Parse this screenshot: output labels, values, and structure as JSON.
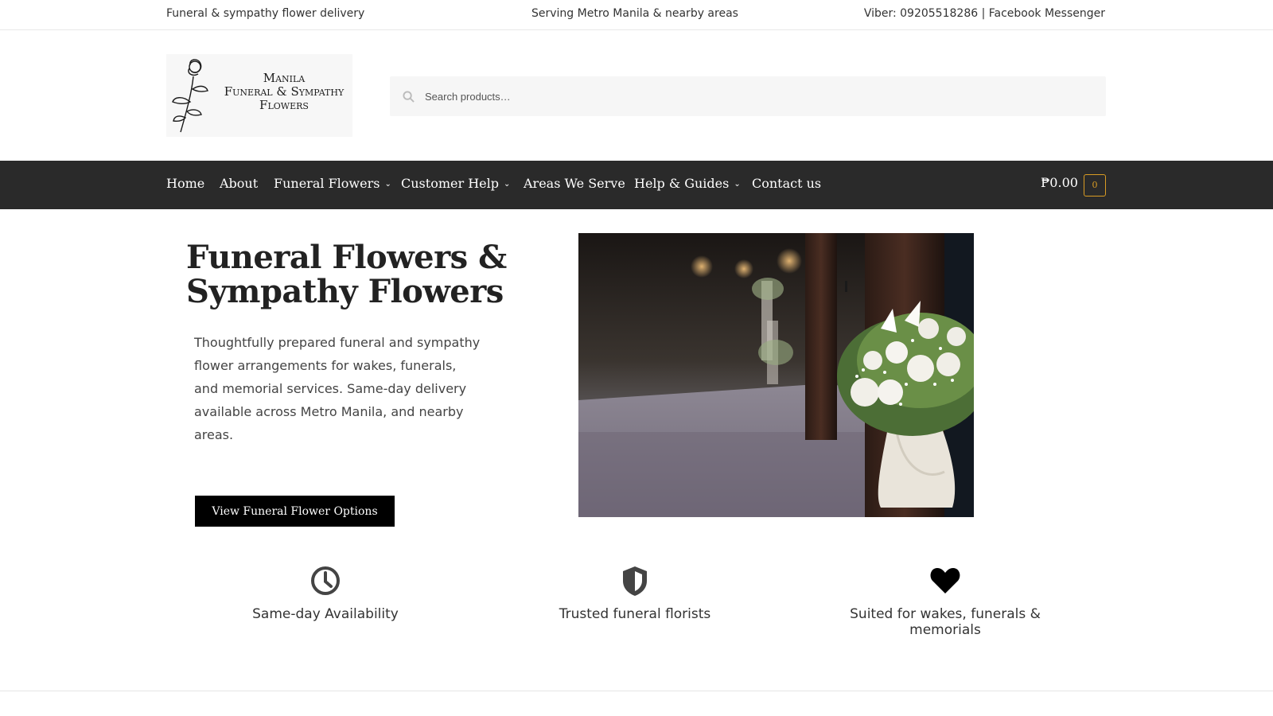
{
  "topbar": {
    "left": "Funeral & sympathy flower delivery",
    "center": "Serving Metro Manila & nearby areas",
    "right": "Viber: 09205518286 | Facebook Messenger"
  },
  "logo": {
    "line1": "Manila",
    "line2": "Funeral & Sympathy",
    "line3": "Flowers",
    "icon": "rose-icon"
  },
  "search": {
    "placeholder": "Search products…",
    "icon": "search-icon"
  },
  "nav": {
    "items": [
      {
        "label": "Home",
        "dropdown": false
      },
      {
        "label": "About",
        "dropdown": false
      },
      {
        "label": "Funeral Flowers",
        "dropdown": true
      },
      {
        "label": "Customer Help",
        "dropdown": true
      },
      {
        "label": "Areas We Serve",
        "dropdown": false
      },
      {
        "label": "Help & Guides",
        "dropdown": true
      },
      {
        "label": "Contact us",
        "dropdown": false
      }
    ],
    "cart_total": "₱0.00",
    "cart_count": "0"
  },
  "hero": {
    "title": "Funeral Flowers & Sympathy Flowers",
    "description": "Thoughtfully prepared funeral and sympathy flower arrangements for wakes, funerals, and memorial services. Same-day delivery available across Metro Manila, and nearby areas.",
    "button_label": "View Funeral Flower Options"
  },
  "features": [
    {
      "label": "Same-day Availability",
      "icon": "clock-icon"
    },
    {
      "label": "Trusted funeral florists",
      "icon": "shield-icon"
    },
    {
      "label": "Suited for wakes, funerals & memorials",
      "icon": "heart-icon"
    }
  ],
  "colors": {
    "nav_bg": "#2a2a2a",
    "cart_accent": "#d99c24",
    "button_bg": "#000000"
  }
}
